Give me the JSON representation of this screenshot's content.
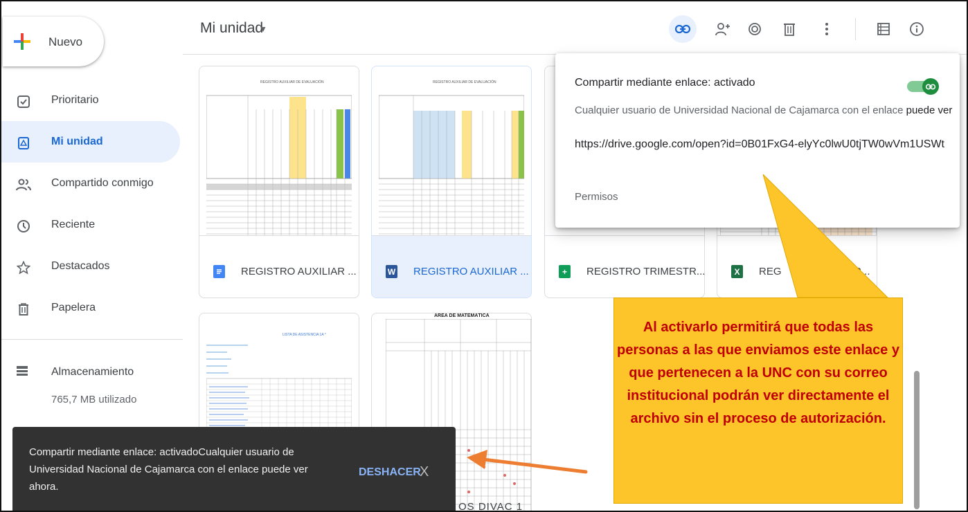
{
  "sidebar": {
    "new_label": "Nuevo",
    "items": [
      {
        "label": "Prioritario",
        "icon": "checkbox-icon"
      },
      {
        "label": "Mi unidad",
        "icon": "drive-icon"
      },
      {
        "label": "Compartido conmigo",
        "icon": "people-icon"
      },
      {
        "label": "Reciente",
        "icon": "clock-icon"
      },
      {
        "label": "Destacados",
        "icon": "star-icon"
      },
      {
        "label": "Papelera",
        "icon": "trash-icon"
      }
    ],
    "storage_label": "Almacenamiento",
    "storage_used": "765,7 MB utilizado"
  },
  "header": {
    "title": "Mi unidad",
    "toolbar_icons": [
      "link-icon",
      "add-person-icon",
      "preview-eye-icon",
      "trash-icon",
      "more-vert-icon",
      "list-view-icon",
      "info-icon"
    ]
  },
  "files": [
    {
      "name": "REGISTRO AUXILIAR ...",
      "type": "docs",
      "badge": "",
      "color": "#4285f4"
    },
    {
      "name": "REGISTRO AUXILIAR ...",
      "type": "word",
      "badge": "W",
      "color": "#2b579a"
    },
    {
      "name": "REGISTRO TRIMESTR...",
      "type": "sheets",
      "badge": "+",
      "color": "#0f9d58"
    },
    {
      "name": "REG",
      "name_tail": "ESTR...",
      "type": "excel",
      "badge": "X",
      "color": "#1e7145"
    }
  ],
  "thumbs": {
    "doc1_title": "REGISTRO AUXILIAR DE EVALUACIÓN",
    "doc3_title": "LISTA DE ASISTENCIA 1A °",
    "doc4_title": "ÁREA DE MATEMÁTICA"
  },
  "share_popup": {
    "title": "Compartir mediante enlace: activado",
    "description_prefix": "Cualquier usuario de Universidad Nacional de Cajamarca con el enlace ",
    "description_bold": "puede ver",
    "link": "https://drive.google.com/open?id=0B01FxG4-elyYc0lwU0tjTW0wVm1USWt",
    "permissions": "Permisos"
  },
  "snackbar": {
    "message": "Compartir mediante enlace: activadoCualquier usuario de Universidad Nacional de Cajamarca con el enlace puede ver ahora.",
    "undo": "DESHACER",
    "close": "X"
  },
  "partial_label": "OS DIVAC 1",
  "annotation": {
    "text": "Al activarlo permitirá que todas las personas a las que enviamos este enlace y que pertenecen a la UNC con su correo institucional podrán ver directamente el archivo sin el proceso de autorización.",
    "color": "#c00000",
    "bg": "#fdc52a"
  },
  "colors": {
    "accent": "#1967d2",
    "toggle_on": "#1e8e3e",
    "arrow": "#ed7d31"
  }
}
